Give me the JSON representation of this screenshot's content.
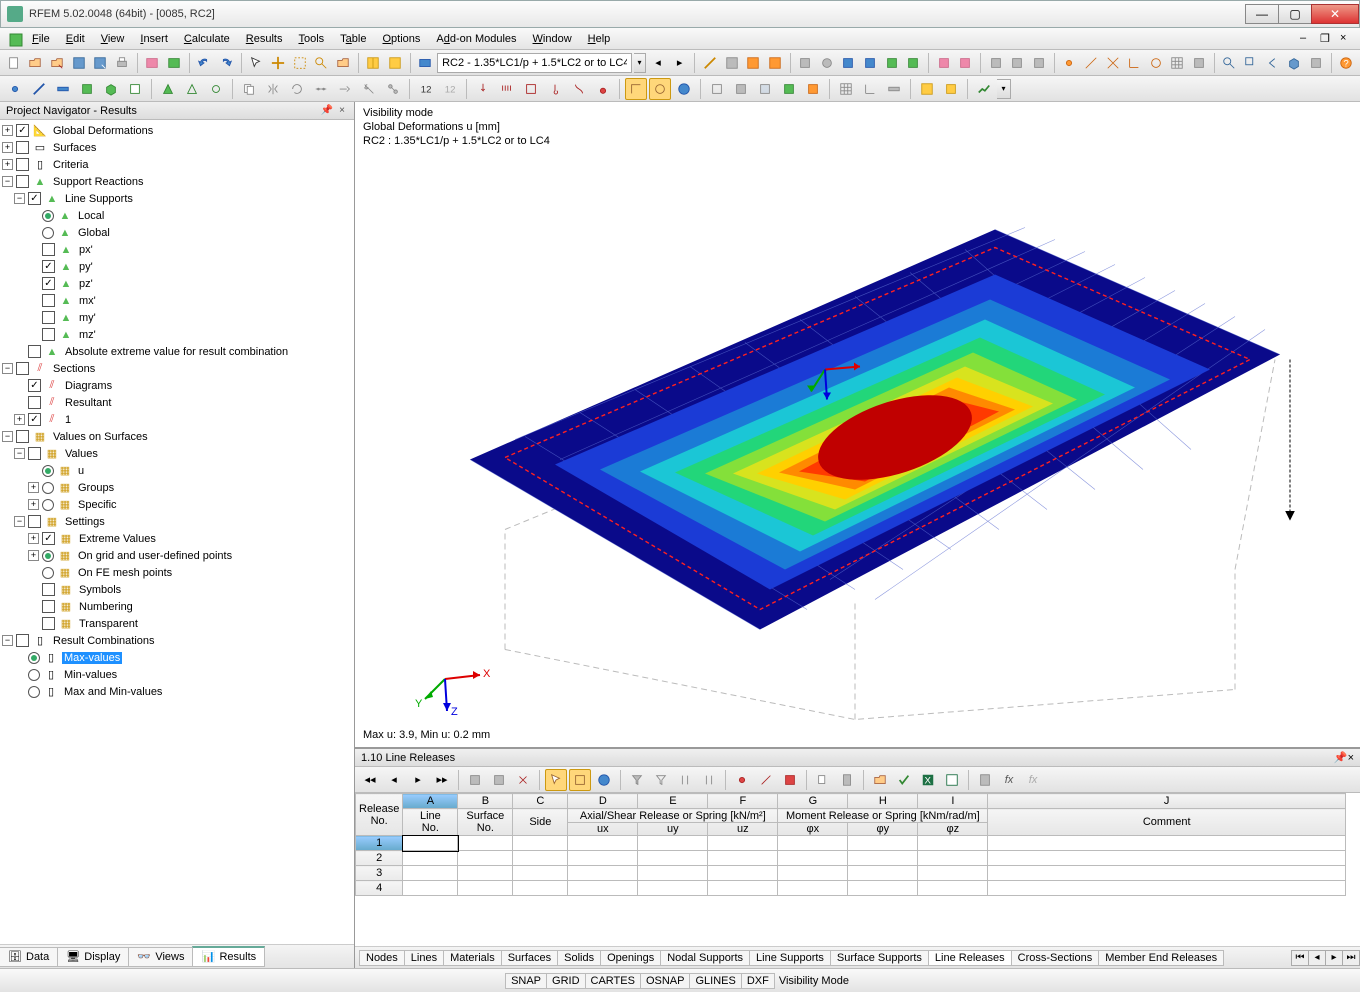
{
  "title": "RFEM 5.02.0048 (64bit) - [0085, RC2]",
  "menu": [
    "File",
    "Edit",
    "View",
    "Insert",
    "Calculate",
    "Results",
    "Tools",
    "Table",
    "Options",
    "Add-on Modules",
    "Window",
    "Help"
  ],
  "toolbar1": {
    "combo": "RC2 - 1.35*LC1/p + 1.5*LC2 or to LC4"
  },
  "navigator": {
    "title": "Project Navigator - Results",
    "tabs": [
      "Data",
      "Display",
      "Views",
      "Results"
    ],
    "activeTab": 3,
    "tree": {
      "globalDeformations": {
        "label": "Global Deformations",
        "checked": true
      },
      "surfaces": {
        "label": "Surfaces",
        "checked": false
      },
      "criteria": {
        "label": "Criteria",
        "checked": false
      },
      "supportReactions": {
        "label": "Support Reactions",
        "checked": false
      },
      "lineSupports": {
        "label": "Line Supports",
        "checked": true,
        "items": [
          {
            "label": "Local",
            "type": "radio",
            "sel": true
          },
          {
            "label": "Global",
            "type": "radio",
            "sel": false
          },
          {
            "label": "px'",
            "type": "check",
            "sel": false
          },
          {
            "label": "py'",
            "type": "check",
            "sel": true
          },
          {
            "label": "pz'",
            "type": "check",
            "sel": true
          },
          {
            "label": "mx'",
            "type": "check",
            "sel": false
          },
          {
            "label": "my'",
            "type": "check",
            "sel": false
          },
          {
            "label": "mz'",
            "type": "check",
            "sel": false
          }
        ],
        "extreme": "Absolute extreme value for result combination"
      },
      "sections": {
        "label": "Sections",
        "checked": false,
        "items": [
          {
            "label": "Diagrams",
            "sel": true
          },
          {
            "label": "Resultant",
            "sel": false
          },
          {
            "label": "1",
            "sel": true
          }
        ]
      },
      "valuesOnSurfaces": {
        "label": "Values on Surfaces",
        "checked": false,
        "values": {
          "label": "Values",
          "checked": false,
          "items": [
            {
              "label": "u",
              "type": "radio",
              "sel": true
            },
            {
              "label": "Groups",
              "type": "radio",
              "sel": false
            },
            {
              "label": "Specific",
              "type": "radio",
              "sel": false
            }
          ]
        },
        "settings": {
          "label": "Settings",
          "checked": false,
          "items": [
            {
              "label": "Extreme Values",
              "type": "check",
              "sel": true
            },
            {
              "label": "On grid and user-defined points",
              "type": "radio",
              "sel": true
            },
            {
              "label": "On FE mesh points",
              "type": "radio",
              "sel": false
            },
            {
              "label": "Symbols",
              "type": "check",
              "sel": false
            },
            {
              "label": "Numbering",
              "type": "check",
              "sel": false
            },
            {
              "label": "Transparent",
              "type": "check",
              "sel": false
            }
          ]
        }
      },
      "resultCombinations": {
        "label": "Result Combinations",
        "checked": false,
        "items": [
          {
            "label": "Max-values",
            "type": "radio",
            "sel": true,
            "highlight": true
          },
          {
            "label": "Min-values",
            "type": "radio",
            "sel": false
          },
          {
            "label": "Max and Min-values",
            "type": "radio",
            "sel": false
          }
        ]
      }
    }
  },
  "viewport": {
    "line1": "Visibility mode",
    "line2": "Global Deformations u [mm]",
    "line3": "RC2 : 1.35*LC1/p + 1.5*LC2 or to LC4",
    "footer": "Max u: 3.9, Min u: 0.2 mm",
    "axes": {
      "x": "X",
      "y": "Y",
      "z": "Z"
    }
  },
  "bottomPanel": {
    "title": "1.10 Line Releases",
    "headers": {
      "release": "Release",
      "line": "Line",
      "surface": "Surface",
      "side": "Side",
      "axial": "Axial/Shear Release or Spring [kN/m²]",
      "moment": "Moment Release or Spring [kNm/rad/m]",
      "no": "No.",
      "ux": "ux",
      "uy": "uy",
      "uz": "uz",
      "px": "φx",
      "py": "φy",
      "pz": "φz",
      "comment": "Comment",
      "cols": [
        "A",
        "B",
        "C",
        "D",
        "E",
        "F",
        "G",
        "H",
        "I",
        "J"
      ]
    },
    "rows": [
      1,
      2,
      3,
      4
    ],
    "tabs": [
      "Nodes",
      "Lines",
      "Materials",
      "Surfaces",
      "Solids",
      "Openings",
      "Nodal Supports",
      "Line Supports",
      "Surface Supports",
      "Line Releases",
      "Cross-Sections",
      "Member End Releases"
    ],
    "activeTab": 9
  },
  "statusbar": {
    "items": [
      "SNAP",
      "GRID",
      "CARTES",
      "OSNAP",
      "GLINES",
      "DXF",
      "Visibility Mode"
    ]
  },
  "chart_data": {
    "type": "heatmap",
    "title": "Global Deformations u [mm]",
    "colorscale": [
      [
        0.2,
        "#0a0a8a"
      ],
      [
        0.6,
        "#1b3bd6"
      ],
      [
        1.0,
        "#1b7bd6"
      ],
      [
        1.5,
        "#1bc6d6"
      ],
      [
        2.0,
        "#22d67a"
      ],
      [
        2.5,
        "#84e03a"
      ],
      [
        3.0,
        "#d8e31e"
      ],
      [
        3.2,
        "#ffd000"
      ],
      [
        3.5,
        "#ff8a00"
      ],
      [
        3.7,
        "#ff3a00"
      ],
      [
        3.9,
        "#c00000"
      ]
    ],
    "min": 0.2,
    "max": 3.9,
    "units": "mm",
    "note": "Concentric contour bands across a roughly-square slab; maximum near center, minimum at edges."
  }
}
